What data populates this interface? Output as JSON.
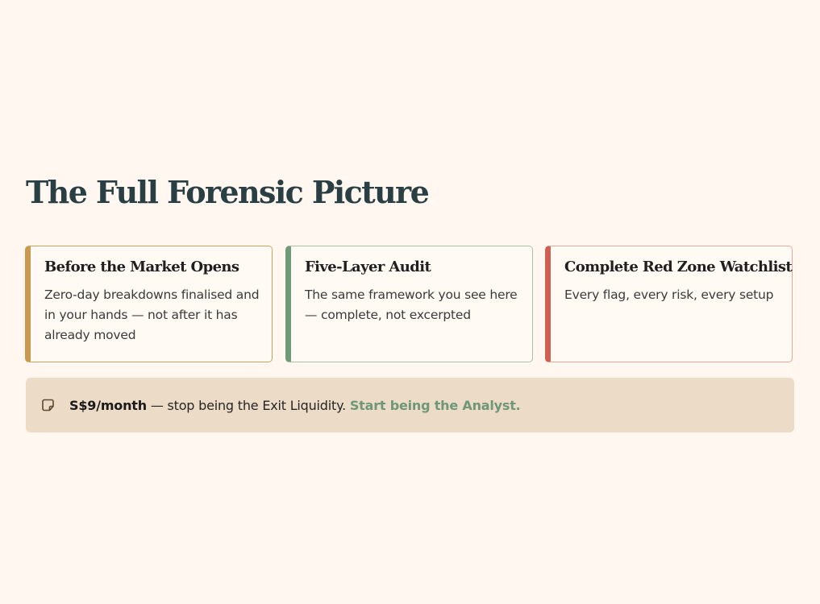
{
  "heading": "The Full Forensic Picture",
  "cards": [
    {
      "title": "Before the Market Opens",
      "description": "Zero-day breakdowns finalised and in your hands — not after it has already moved",
      "accent_color": "#c99a4e"
    },
    {
      "title": "Five-Layer Audit",
      "description": "The same framework you see here — complete, not excerpted",
      "accent_color": "#6f9a78"
    },
    {
      "title": "Complete Red Zone Watchlist",
      "description": "Every flag, every risk, every setup",
      "accent_color": "#cf5f52"
    }
  ],
  "cta": {
    "icon": "note-icon",
    "price": "S$9/month",
    "text": " — stop being the Exit Liquidity. ",
    "link_label": "Start being the Analyst.",
    "link_color": "#6f9778"
  }
}
